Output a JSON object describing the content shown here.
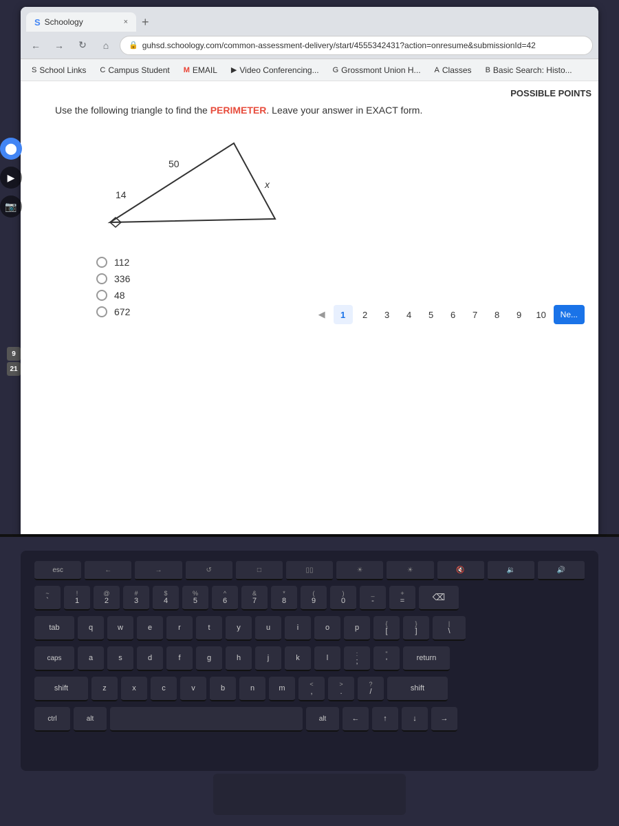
{
  "browser": {
    "tab_favicon": "S",
    "tab_label": "Schoology",
    "tab_close": "×",
    "tab_new": "+",
    "nav_back": "←",
    "nav_forward": "→",
    "nav_refresh": "↻",
    "nav_home": "⌂",
    "url": "guhsd.schoology.com/common-assessment-delivery/start/4555342431?action=onresume&submissionId=42",
    "lock_icon": "🔒"
  },
  "bookmarks": [
    {
      "icon": "S",
      "label": "School Links"
    },
    {
      "icon": "C",
      "label": "Campus Student"
    },
    {
      "icon": "M",
      "label": "EMAIL"
    },
    {
      "icon": "▶",
      "label": "Video Conferencing..."
    },
    {
      "icon": "G",
      "label": "Grossmont Union H..."
    },
    {
      "icon": "A",
      "label": "Classes"
    },
    {
      "icon": "B",
      "label": "Basic Search: Histo..."
    }
  ],
  "page": {
    "possible_points_label": "POSSIBLE POINTS",
    "question_text_pre": "Use the following triangle to find the ",
    "question_keyword": "PERIMETER",
    "question_text_post": ". Leave your answer in EXACT form.",
    "triangle": {
      "side_top": "50",
      "side_left": "14",
      "side_right": "x"
    },
    "choices": [
      {
        "value": "112",
        "selected": false
      },
      {
        "value": "336",
        "selected": false
      },
      {
        "value": "48",
        "selected": false
      },
      {
        "value": "672",
        "selected": false
      }
    ],
    "pagination": {
      "pages": [
        "1",
        "2",
        "3",
        "4",
        "5",
        "6",
        "7",
        "8",
        "9",
        "10"
      ],
      "current": "1",
      "next_label": "Ne..."
    }
  },
  "sidebar": {
    "badge_top": "9",
    "badge_bottom": "21"
  },
  "keyboard": {
    "esc": "esc",
    "rows": [
      [
        "←",
        "→",
        "C",
        "□",
        "▯▯",
        "o",
        "○",
        "◂",
        "◂"
      ],
      [
        "!",
        "@",
        "#",
        "$",
        "%",
        "^",
        "&",
        "*",
        "(",
        ")",
        "-"
      ],
      [
        "1",
        "2",
        "3",
        "4",
        "5",
        "6",
        "7",
        "8",
        "9",
        "0",
        ""
      ],
      [
        "tab",
        "q",
        "w",
        "e",
        "r",
        "t",
        "y",
        "u",
        "i",
        "o",
        "p"
      ],
      [
        "a",
        "s",
        "d",
        "f",
        "g",
        "h",
        "j",
        "k",
        "l"
      ]
    ]
  }
}
